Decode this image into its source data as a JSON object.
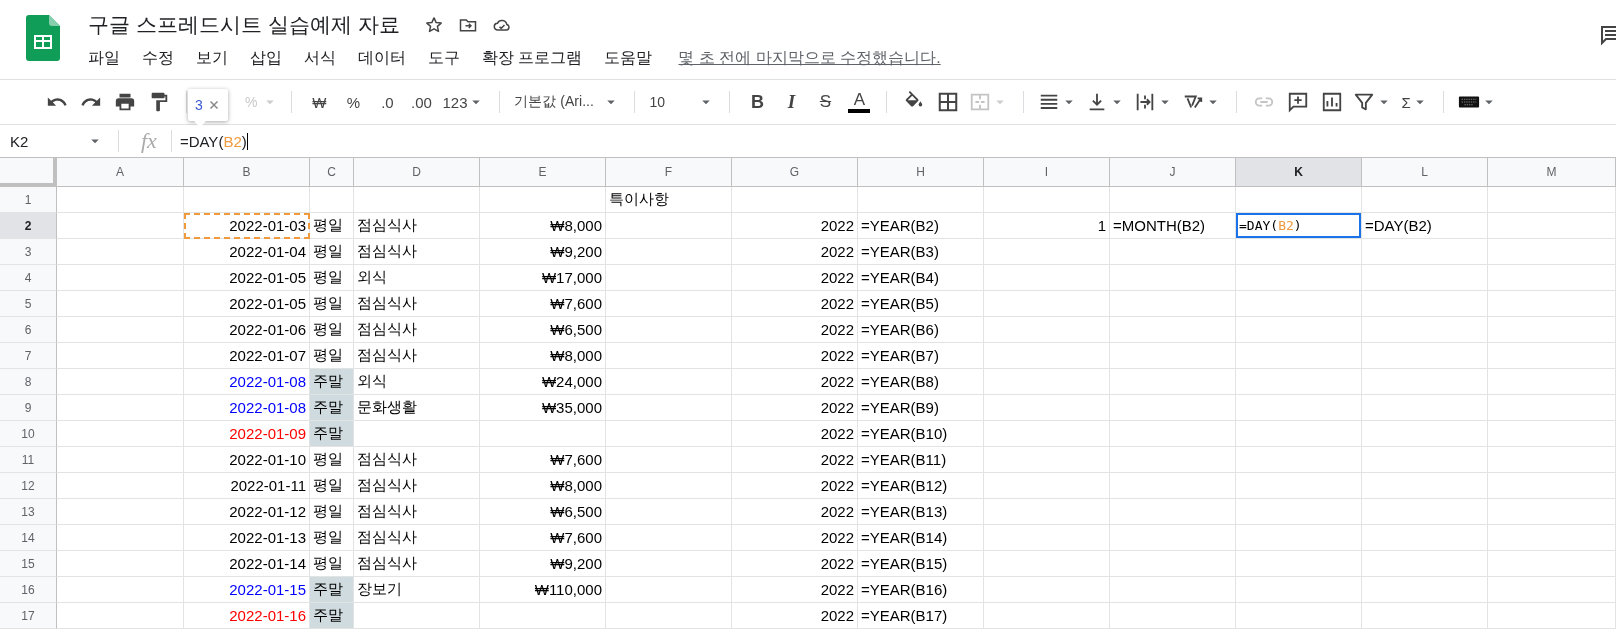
{
  "document": {
    "title": "구글 스프레드시트 실습예제 자료",
    "last_edit": "몇 초 전에 마지막으로 수정했습니다."
  },
  "menu": [
    {
      "label": "파일"
    },
    {
      "label": "수정"
    },
    {
      "label": "보기"
    },
    {
      "label": "삽입"
    },
    {
      "label": "서식"
    },
    {
      "label": "데이터"
    },
    {
      "label": "도구"
    },
    {
      "label": "확장 프로그램"
    },
    {
      "label": "도움말"
    }
  ],
  "toolbar": {
    "zoom_visible": "%",
    "currency": "₩",
    "percent": "%",
    "dec_less": ".0",
    "dec_more": ".00",
    "format": "123",
    "font": "기본값 (Ari...",
    "size": "10",
    "bold": "B",
    "italic": "I",
    "strike": "S",
    "text_color": "A",
    "sum": "Σ"
  },
  "tooltip": {
    "text": "3"
  },
  "formula_bar": {
    "cell_ref": "K2",
    "fx": "fx",
    "parts": [
      {
        "text": "=DAY(",
        "kind": "plain"
      },
      {
        "text": "B2",
        "kind": "ref"
      },
      {
        "text": ")",
        "kind": "plain"
      }
    ]
  },
  "grid": {
    "columns": [
      {
        "label": "A",
        "selected": false
      },
      {
        "label": "B",
        "selected": false
      },
      {
        "label": "C",
        "selected": false
      },
      {
        "label": "D",
        "selected": false
      },
      {
        "label": "E",
        "selected": false
      },
      {
        "label": "F",
        "selected": false
      },
      {
        "label": "G",
        "selected": false
      },
      {
        "label": "H",
        "selected": false
      },
      {
        "label": "I",
        "selected": false
      },
      {
        "label": "J",
        "selected": false
      },
      {
        "label": "K",
        "selected": true
      },
      {
        "label": "L",
        "selected": false
      },
      {
        "label": "M",
        "selected": false
      }
    ],
    "rows": [
      {
        "num": "1",
        "selected": false,
        "cells": [
          null,
          null,
          null,
          null,
          null,
          {
            "text": "특이사항",
            "kind": "text"
          },
          null,
          null,
          null,
          null,
          null,
          null,
          null
        ]
      },
      {
        "num": "2",
        "selected": true,
        "cells": [
          null,
          {
            "text": "2022-01-03",
            "kind": "number",
            "color": "#000000",
            "referenced": true
          },
          {
            "text": "평일",
            "kind": "text",
            "shaded": false
          },
          {
            "text": "점심식사",
            "kind": "text"
          },
          {
            "text": "₩8,000",
            "kind": "number"
          },
          null,
          {
            "text": "2022",
            "kind": "number"
          },
          {
            "text": "=YEAR(B2)",
            "kind": "text"
          },
          {
            "text": "1",
            "kind": "number"
          },
          {
            "text": "=MONTH(B2)",
            "kind": "text"
          },
          {
            "kind": "editing",
            "active": true,
            "parts": [
              {
                "text": "=DAY(",
                "kind": "plain"
              },
              {
                "text": "B2",
                "kind": "ref"
              },
              {
                "text": ")",
                "kind": "plain"
              }
            ]
          },
          {
            "text": "=DAY(B2)",
            "kind": "text"
          },
          null
        ]
      },
      {
        "num": "3",
        "selected": false,
        "cells": [
          null,
          {
            "text": "2022-01-04",
            "kind": "number",
            "color": "#000000"
          },
          {
            "text": "평일",
            "kind": "text",
            "shaded": false
          },
          {
            "text": "점심식사",
            "kind": "text"
          },
          {
            "text": "₩9,200",
            "kind": "number"
          },
          null,
          {
            "text": "2022",
            "kind": "number"
          },
          {
            "text": "=YEAR(B3)",
            "kind": "text"
          },
          null,
          null,
          null,
          null,
          null
        ]
      },
      {
        "num": "4",
        "selected": false,
        "cells": [
          null,
          {
            "text": "2022-01-05",
            "kind": "number",
            "color": "#000000"
          },
          {
            "text": "평일",
            "kind": "text",
            "shaded": false
          },
          {
            "text": "외식",
            "kind": "text"
          },
          {
            "text": "₩17,000",
            "kind": "number"
          },
          null,
          {
            "text": "2022",
            "kind": "number"
          },
          {
            "text": "=YEAR(B4)",
            "kind": "text"
          },
          null,
          null,
          null,
          null,
          null
        ]
      },
      {
        "num": "5",
        "selected": false,
        "cells": [
          null,
          {
            "text": "2022-01-05",
            "kind": "number",
            "color": "#000000"
          },
          {
            "text": "평일",
            "kind": "text",
            "shaded": false
          },
          {
            "text": "점심식사",
            "kind": "text"
          },
          {
            "text": "₩7,600",
            "kind": "number"
          },
          null,
          {
            "text": "2022",
            "kind": "number"
          },
          {
            "text": "=YEAR(B5)",
            "kind": "text"
          },
          null,
          null,
          null,
          null,
          null
        ]
      },
      {
        "num": "6",
        "selected": false,
        "cells": [
          null,
          {
            "text": "2022-01-06",
            "kind": "number",
            "color": "#000000"
          },
          {
            "text": "평일",
            "kind": "text",
            "shaded": false
          },
          {
            "text": "점심식사",
            "kind": "text"
          },
          {
            "text": "₩6,500",
            "kind": "number"
          },
          null,
          {
            "text": "2022",
            "kind": "number"
          },
          {
            "text": "=YEAR(B6)",
            "kind": "text"
          },
          null,
          null,
          null,
          null,
          null
        ]
      },
      {
        "num": "7",
        "selected": false,
        "cells": [
          null,
          {
            "text": "2022-01-07",
            "kind": "number",
            "color": "#000000"
          },
          {
            "text": "평일",
            "kind": "text",
            "shaded": false
          },
          {
            "text": "점심식사",
            "kind": "text"
          },
          {
            "text": "₩8,000",
            "kind": "number"
          },
          null,
          {
            "text": "2022",
            "kind": "number"
          },
          {
            "text": "=YEAR(B7)",
            "kind": "text"
          },
          null,
          null,
          null,
          null,
          null
        ]
      },
      {
        "num": "8",
        "selected": false,
        "cells": [
          null,
          {
            "text": "2022-01-08",
            "kind": "number",
            "color": "#0000ff"
          },
          {
            "text": "주말",
            "kind": "text",
            "shaded": true
          },
          {
            "text": "외식",
            "kind": "text"
          },
          {
            "text": "₩24,000",
            "kind": "number"
          },
          null,
          {
            "text": "2022",
            "kind": "number"
          },
          {
            "text": "=YEAR(B8)",
            "kind": "text"
          },
          null,
          null,
          null,
          null,
          null
        ]
      },
      {
        "num": "9",
        "selected": false,
        "cells": [
          null,
          {
            "text": "2022-01-08",
            "kind": "number",
            "color": "#0000ff"
          },
          {
            "text": "주말",
            "kind": "text",
            "shaded": true
          },
          {
            "text": "문화생활",
            "kind": "text"
          },
          {
            "text": "₩35,000",
            "kind": "number"
          },
          null,
          {
            "text": "2022",
            "kind": "number"
          },
          {
            "text": "=YEAR(B9)",
            "kind": "text"
          },
          null,
          null,
          null,
          null,
          null
        ]
      },
      {
        "num": "10",
        "selected": false,
        "cells": [
          null,
          {
            "text": "2022-01-09",
            "kind": "number",
            "color": "#ff0000"
          },
          {
            "text": "주말",
            "kind": "text",
            "shaded": true
          },
          null,
          null,
          null,
          {
            "text": "2022",
            "kind": "number"
          },
          {
            "text": "=YEAR(B10)",
            "kind": "text"
          },
          null,
          null,
          null,
          null,
          null
        ]
      },
      {
        "num": "11",
        "selected": false,
        "cells": [
          null,
          {
            "text": "2022-01-10",
            "kind": "number",
            "color": "#000000"
          },
          {
            "text": "평일",
            "kind": "text",
            "shaded": false
          },
          {
            "text": "점심식사",
            "kind": "text"
          },
          {
            "text": "₩7,600",
            "kind": "number"
          },
          null,
          {
            "text": "2022",
            "kind": "number"
          },
          {
            "text": "=YEAR(B11)",
            "kind": "text"
          },
          null,
          null,
          null,
          null,
          null
        ]
      },
      {
        "num": "12",
        "selected": false,
        "cells": [
          null,
          {
            "text": "2022-01-11",
            "kind": "number",
            "color": "#000000"
          },
          {
            "text": "평일",
            "kind": "text",
            "shaded": false
          },
          {
            "text": "점심식사",
            "kind": "text"
          },
          {
            "text": "₩8,000",
            "kind": "number"
          },
          null,
          {
            "text": "2022",
            "kind": "number"
          },
          {
            "text": "=YEAR(B12)",
            "kind": "text"
          },
          null,
          null,
          null,
          null,
          null
        ]
      },
      {
        "num": "13",
        "selected": false,
        "cells": [
          null,
          {
            "text": "2022-01-12",
            "kind": "number",
            "color": "#000000"
          },
          {
            "text": "평일",
            "kind": "text",
            "shaded": false
          },
          {
            "text": "점심식사",
            "kind": "text"
          },
          {
            "text": "₩6,500",
            "kind": "number"
          },
          null,
          {
            "text": "2022",
            "kind": "number"
          },
          {
            "text": "=YEAR(B13)",
            "kind": "text"
          },
          null,
          null,
          null,
          null,
          null
        ]
      },
      {
        "num": "14",
        "selected": false,
        "cells": [
          null,
          {
            "text": "2022-01-13",
            "kind": "number",
            "color": "#000000"
          },
          {
            "text": "평일",
            "kind": "text",
            "shaded": false
          },
          {
            "text": "점심식사",
            "kind": "text"
          },
          {
            "text": "₩7,600",
            "kind": "number"
          },
          null,
          {
            "text": "2022",
            "kind": "number"
          },
          {
            "text": "=YEAR(B14)",
            "kind": "text"
          },
          null,
          null,
          null,
          null,
          null
        ]
      },
      {
        "num": "15",
        "selected": false,
        "cells": [
          null,
          {
            "text": "2022-01-14",
            "kind": "number",
            "color": "#000000"
          },
          {
            "text": "평일",
            "kind": "text",
            "shaded": false
          },
          {
            "text": "점심식사",
            "kind": "text"
          },
          {
            "text": "₩9,200",
            "kind": "number"
          },
          null,
          {
            "text": "2022",
            "kind": "number"
          },
          {
            "text": "=YEAR(B15)",
            "kind": "text"
          },
          null,
          null,
          null,
          null,
          null
        ]
      },
      {
        "num": "16",
        "selected": false,
        "cells": [
          null,
          {
            "text": "2022-01-15",
            "kind": "number",
            "color": "#0000ff"
          },
          {
            "text": "주말",
            "kind": "text",
            "shaded": true
          },
          {
            "text": "장보기",
            "kind": "text"
          },
          {
            "text": "₩110,000",
            "kind": "number"
          },
          null,
          {
            "text": "2022",
            "kind": "number"
          },
          {
            "text": "=YEAR(B16)",
            "kind": "text"
          },
          null,
          null,
          null,
          null,
          null
        ]
      },
      {
        "num": "17",
        "selected": false,
        "cells": [
          null,
          {
            "text": "2022-01-16",
            "kind": "number",
            "color": "#ff0000"
          },
          {
            "text": "주말",
            "kind": "text",
            "shaded": true
          },
          null,
          null,
          null,
          {
            "text": "2022",
            "kind": "number"
          },
          {
            "text": "=YEAR(B17)",
            "kind": "text"
          },
          null,
          null,
          null,
          null,
          null
        ]
      }
    ]
  }
}
